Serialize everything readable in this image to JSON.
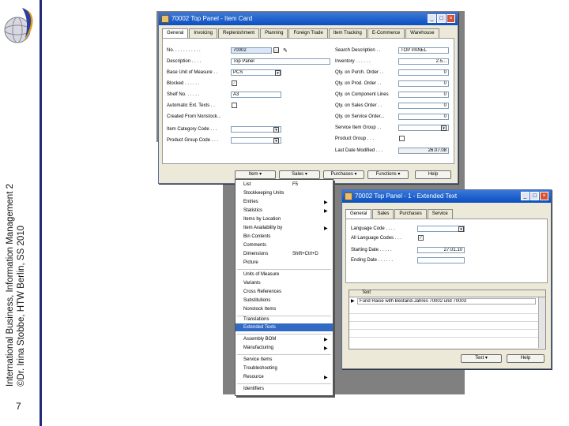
{
  "slide": {
    "side_text_line1": "International Business, Information Management 2",
    "side_text_line2": "©Dr. Irina Stobbe, HTW Berlin, SS 2010",
    "page_number": "7",
    "accent_color": "#1f2a7a"
  },
  "item_card": {
    "title": "70002 Top Panel - Item Card",
    "tabs": [
      "General",
      "Invoicing",
      "Replenishment",
      "Planning",
      "Foreign Trade",
      "Item Tracking",
      "E-Commerce",
      "Warehouse"
    ],
    "active_tab": "General",
    "left_labels": [
      "No. . . . . . .  . . . .",
      "Description  . . . .",
      "Base Unit of Measure . .",
      "Blocked . . . . . .",
      "Shelf No. . . . . .",
      "Automatic Ext. Texts . .",
      "Created From Nonstock...",
      "Item Category Code . . .",
      "Product Group Code . . ."
    ],
    "fields": {
      "no": "70002",
      "description": "Top Panel",
      "base_uom": "PCS",
      "shelf_no": "A3"
    },
    "right_labels": [
      "Search Description . .",
      "Inventory . . . . . .",
      "Qty. on Purch. Order . .",
      "Qty. on Prod. Order . .",
      "Qty. on Component Lines",
      "Qty. on Sales Order . .",
      "Qty. on Service Order...",
      "Service Item Group . .",
      "Product Group . . .",
      "Last Date Modified . . ."
    ],
    "right_fields": {
      "search_description": "TOP PANEL",
      "inventory": "2.5...",
      "qty_purch": "0",
      "qty_prod": "0",
      "qty_comp": "0",
      "qty_sales": "0",
      "qty_service": "0",
      "last_modified": "26.07.08"
    },
    "buttons": {
      "item": "Item",
      "sales": "Sales",
      "purchases": "Purchases",
      "functions": "Functions",
      "help": "Help"
    }
  },
  "item_menu": {
    "items": [
      {
        "label": "List",
        "shortcut": "F5"
      },
      {
        "label": "Stockkeeping Units"
      },
      {
        "label": "Entries",
        "arrow": "▶"
      },
      {
        "label": "Statistics",
        "arrow": "▶"
      },
      {
        "label": "Items by Location"
      },
      {
        "label": "Item Availability by",
        "arrow": "▶"
      },
      {
        "label": "Bin Contents"
      },
      {
        "label": "Comments"
      },
      {
        "label": "Dimensions",
        "shortcut": "Shift+Ctrl+D"
      },
      {
        "label": "Picture"
      },
      {
        "label": "Units of Measure"
      },
      {
        "label": "Variants"
      },
      {
        "label": "Cross References"
      },
      {
        "label": "Substitutions"
      },
      {
        "label": "Nonstock Items"
      },
      {
        "label": "Translations"
      },
      {
        "label": "Extended Texts"
      },
      {
        "label": "Assembly BOM",
        "arrow": "▶"
      },
      {
        "label": "Manufacturing",
        "arrow": "▶"
      },
      {
        "label": "Service Items"
      },
      {
        "label": "Troubleshooting"
      },
      {
        "label": "Resource",
        "arrow": "▶"
      },
      {
        "label": "Identifiers"
      }
    ],
    "highlight_color": "#316ac5"
  },
  "ext_text": {
    "title": "70002 Top Panel - 1 - Extended Text",
    "tabs": [
      "General",
      "Sales",
      "Purchases",
      "Service"
    ],
    "labels": [
      "Language Code . . . .",
      "All Language Codes . . .",
      "Starting Date . . . . .",
      "Ending Date . . . . . ."
    ],
    "starting_date": "27.01.10",
    "grid_header": "Text",
    "grid_row1": "Fund Raise with Bestand-Jahres 70002 und 70003",
    "buttons": {
      "text": "Text",
      "help": "Help"
    }
  }
}
